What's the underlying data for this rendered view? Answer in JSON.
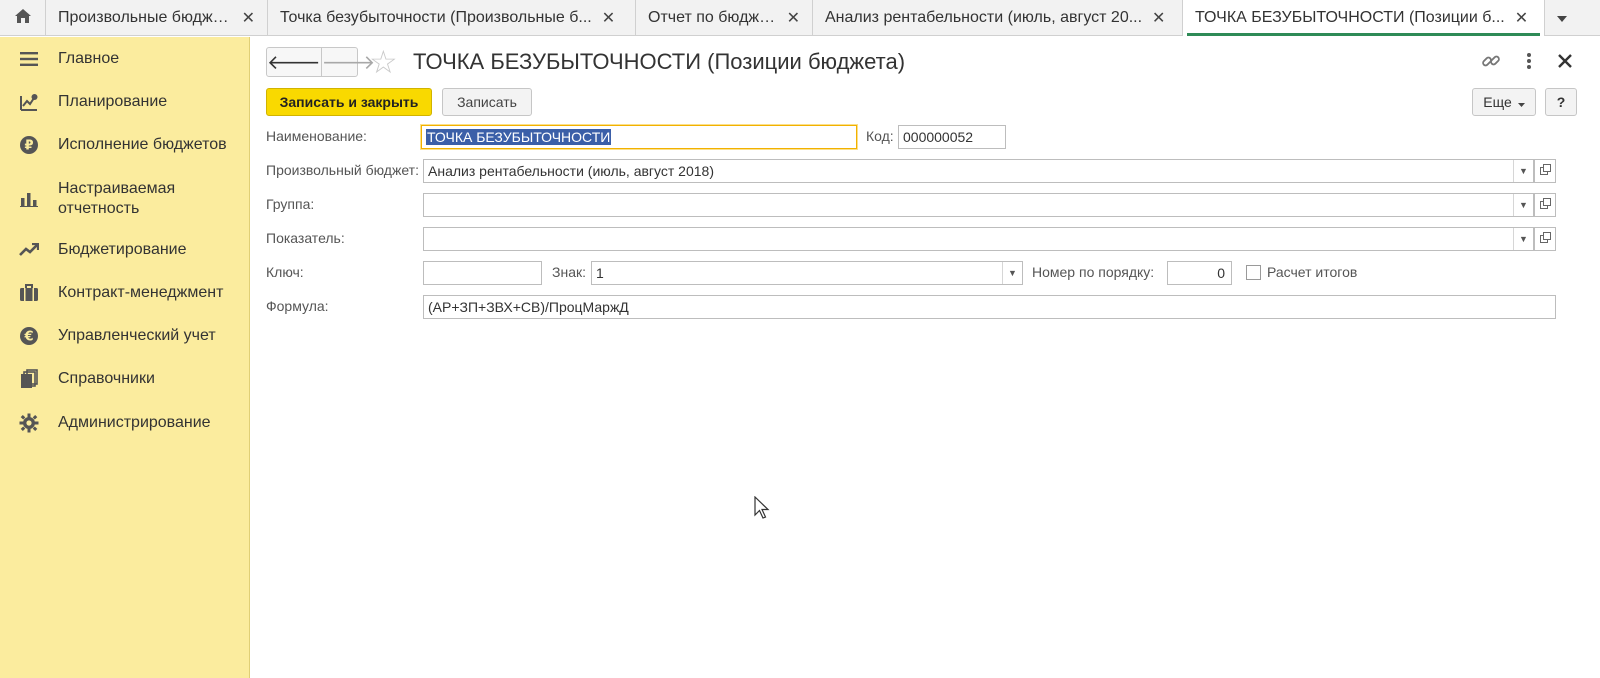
{
  "tabs": {
    "home_icon": "home-icon",
    "items": [
      {
        "label": "Произвольные бюджеты",
        "active": false
      },
      {
        "label": "Точка безубыточности (Произвольные б...",
        "active": false
      },
      {
        "label": "Отчет по бюджету",
        "active": false
      },
      {
        "label": "Анализ рентабельности (июль, август 20...",
        "active": false
      },
      {
        "label": "ТОЧКА БЕЗУБЫТОЧНОСТИ (Позиции б...",
        "active": true
      }
    ],
    "close_glyph": "✕",
    "more_icon": "chevron-down-icon"
  },
  "sidebar": {
    "items": [
      {
        "label": "Главное",
        "icon": "menu-lines-icon"
      },
      {
        "label": "Планирование",
        "icon": "planning-icon"
      },
      {
        "label": "Исполнение бюджетов",
        "icon": "ruble-coin-icon"
      },
      {
        "label": "Настраиваемая отчетность",
        "icon": "bar-chart-icon"
      },
      {
        "label": "Бюджетирование",
        "icon": "trend-up-icon"
      },
      {
        "label": "Контракт-менеджмент",
        "icon": "briefcase-icon"
      },
      {
        "label": "Управленческий учет",
        "icon": "euro-coin-icon"
      },
      {
        "label": "Справочники",
        "icon": "books-icon"
      },
      {
        "label": "Администрирование",
        "icon": "gear-icon"
      }
    ]
  },
  "header": {
    "title": "ТОЧКА БЕЗУБЫТОЧНОСТИ (Позиции бюджета)",
    "back_glyph": "🡐",
    "forward_glyph": "🡒"
  },
  "toolbar": {
    "save_close_label": "Записать и закрыть",
    "save_label": "Записать",
    "more_label": "Еще",
    "help_label": "?"
  },
  "form": {
    "name_label": "Наименование:",
    "name_value": "ТОЧКА БЕЗУБЫТОЧНОСТИ",
    "code_label": "Код:",
    "code_value": "000000052",
    "budget_label": "Произвольный бюджет:",
    "budget_value": "Анализ рентабельности (июль, август 2018)",
    "group_label": "Группа:",
    "group_value": "",
    "indicator_label": "Показатель:",
    "indicator_value": "",
    "key_label": "Ключ:",
    "key_value": "",
    "sign_label": "Знак:",
    "sign_value": "1",
    "order_label": "Номер по порядку:",
    "order_value": "0",
    "totals_label": "Расчет итогов",
    "totals_checked": false,
    "formula_label": "Формула:",
    "formula_value": "(АР+ЗП+ЗВХ+СВ)/ПроцМаржД"
  }
}
